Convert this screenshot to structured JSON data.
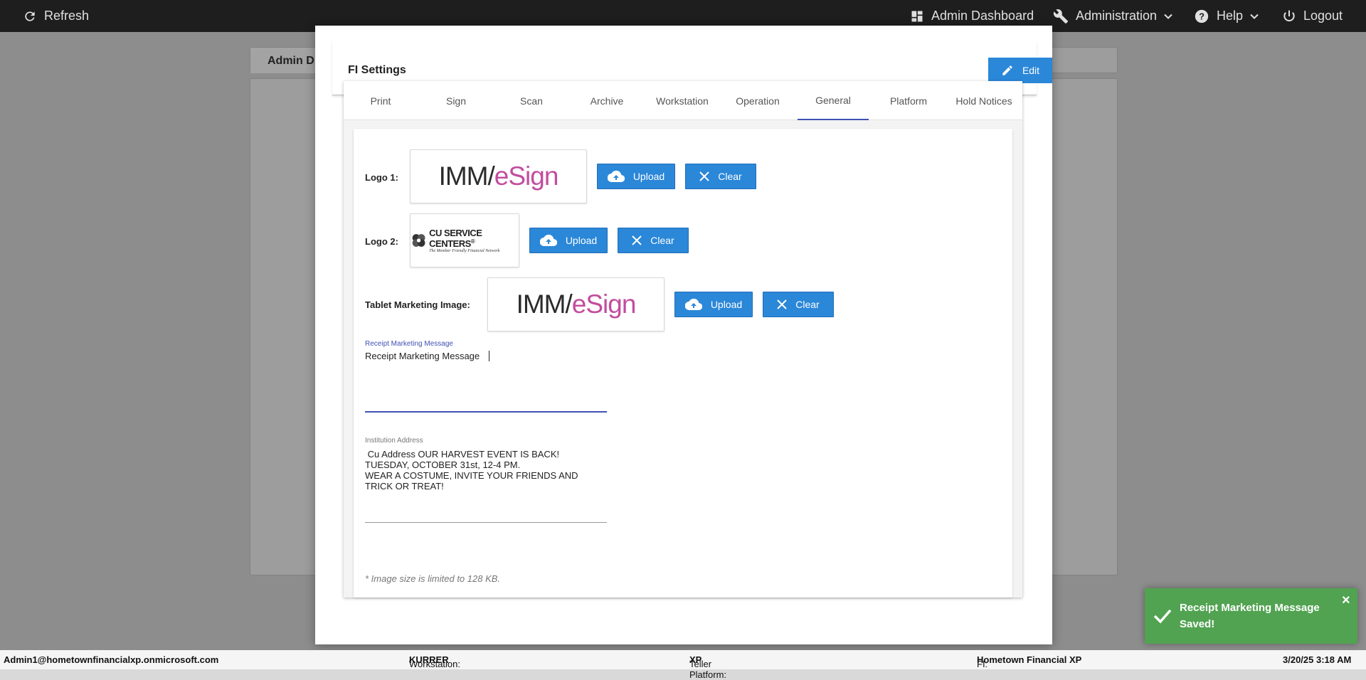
{
  "topbar": {
    "refresh_label": "Refresh",
    "admin_dashboard_label": "Admin Dashboard",
    "administration_label": "Administration",
    "help_label": "Help",
    "logout_label": "Logout"
  },
  "background": {
    "tab_label": "Admin D"
  },
  "modal": {
    "title": "FI Settings",
    "edit_label": "Edit",
    "tabs": [
      {
        "label": "Print"
      },
      {
        "label": "Sign"
      },
      {
        "label": "Scan"
      },
      {
        "label": "Archive"
      },
      {
        "label": "Workstation"
      },
      {
        "label": "Operation"
      },
      {
        "label": "General"
      },
      {
        "label": "Platform"
      },
      {
        "label": "Hold Notices"
      }
    ],
    "active_tab": "General",
    "logo1": {
      "label": "Logo 1:",
      "upload_label": "Upload",
      "clear_label": "Clear",
      "logo_left": "IMM",
      "logo_right": "eSign"
    },
    "logo2": {
      "label": "Logo 2:",
      "upload_label": "Upload",
      "clear_label": "Clear",
      "logo_main": "CU SERVICE CENTERS",
      "logo_reg": "®",
      "logo_tagline": "The Member Friendly Financial Network"
    },
    "tablet": {
      "label": "Tablet Marketing Image:",
      "upload_label": "Upload",
      "clear_label": "Clear",
      "logo_left": "IMM",
      "logo_right": "eSign"
    },
    "receipt": {
      "label": "Receipt Marketing Message",
      "value": "Receipt Marketing Message"
    },
    "address": {
      "label": "Institution Address",
      "value": " Cu Address OUR HARVEST EVENT IS BACK!\nTUESDAY, OCTOBER 31st, 12-4 PM.\nWEAR A COSTUME, INVITE YOUR FRIENDS AND\nTRICK OR TREAT!"
    },
    "note": "* Image size is limited to 128 KB."
  },
  "footer": {
    "user": "Admin1@hometownfinancialxp.onmicrosoft.com",
    "workstation_label": "Workstation:",
    "workstation_value": "KURRER",
    "platform_label": "Teller Platform:",
    "platform_value": "XP",
    "fi_label": "FI:",
    "fi_value": "Hometown Financial XP",
    "datetime": "3/20/25 3:18 AM"
  },
  "toast": {
    "message": "Receipt Marketing Message Saved!",
    "close": "×"
  },
  "colors": {
    "primary_button": "#2b87d8",
    "active_tab_underline": "#3f51b5",
    "toast_success": "#51a351",
    "topbar": "#1e1e1e"
  }
}
